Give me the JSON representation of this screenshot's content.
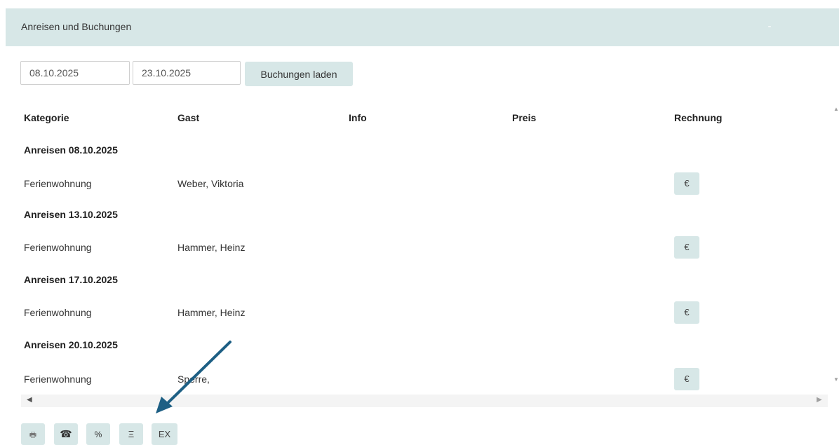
{
  "panel": {
    "title": "Anreisen und Buchungen",
    "collapse_symbol": "-"
  },
  "filter": {
    "date_from": "08.10.2025",
    "date_to": "23.10.2025",
    "load_button_label": "Buchungen laden"
  },
  "table": {
    "headers": {
      "kategorie": "Kategorie",
      "gast": "Gast",
      "info": "Info",
      "preis": "Preis",
      "rechnung": "Rechnung"
    },
    "groups": [
      {
        "heading": "Anreisen 08.10.2025",
        "rows": [
          {
            "kategorie": "Ferienwohnung",
            "gast": "Weber, Viktoria",
            "info": "",
            "preis": "",
            "rechnung_symbol": "€"
          }
        ]
      },
      {
        "heading": "Anreisen 13.10.2025",
        "rows": [
          {
            "kategorie": "Ferienwohnung",
            "gast": "Hammer, Heinz",
            "info": "",
            "preis": "",
            "rechnung_symbol": "€"
          }
        ]
      },
      {
        "heading": "Anreisen 17.10.2025",
        "rows": [
          {
            "kategorie": "Ferienwohnung",
            "gast": "Hammer, Heinz",
            "info": "",
            "preis": "",
            "rechnung_symbol": "€"
          }
        ]
      },
      {
        "heading": "Anreisen 20.10.2025",
        "rows": [
          {
            "kategorie": "Ferienwohnung",
            "gast": "Sperre,",
            "info": "",
            "preis": "",
            "rechnung_symbol": "€"
          }
        ]
      }
    ]
  },
  "scrollbars": {
    "up": "▲",
    "down": "▼",
    "left": "◀",
    "right": "▶"
  },
  "toolbar": {
    "print_symbol": "🖶",
    "phone_symbol": "☎",
    "percent_symbol": "%",
    "list_symbol": "Ξ",
    "export_label": "EX"
  },
  "icons": {
    "print": "printer-icon",
    "phone": "phone-icon",
    "percent": "percent-icon",
    "list": "list-icon",
    "invoice": "euro-icon"
  },
  "colors": {
    "panel_bg": "#d7e7e7",
    "button_bg": "#d7e7e7",
    "annotation_arrow": "#1d5f84"
  }
}
